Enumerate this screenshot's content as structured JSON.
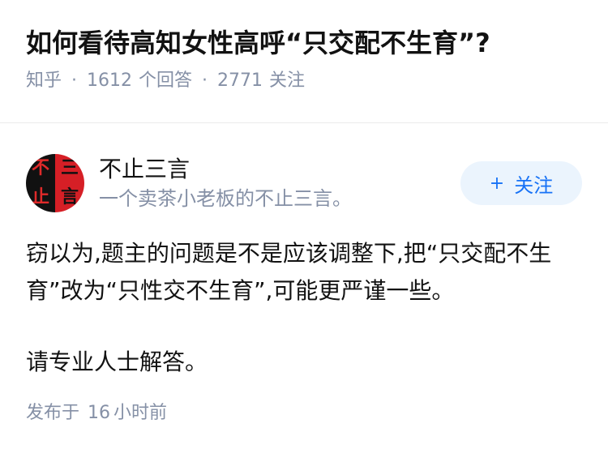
{
  "question": {
    "title": "如何看待高知女性高呼“只交配不生育”?",
    "source": "知乎",
    "answer_count": "1612",
    "answer_label": "个回答",
    "follower_count": "2771",
    "follower_label": "关注"
  },
  "answer": {
    "author": {
      "name": "不止三言",
      "bio": "一个卖茶小老板的不止三言。",
      "avatar_chars": [
        "不",
        "三",
        "止",
        "言"
      ]
    },
    "follow_button": {
      "plus": "+",
      "label": "关注"
    },
    "paragraphs": [
      "窃以为,题主的问题是不是应该调整下,把“只交配不生育”改为“只性交不生育”,可能更严谨一些。",
      "请专业人士解答。"
    ],
    "footer": {
      "published_label": "发布于",
      "published_num": "16",
      "published_unit": "小时前"
    }
  },
  "colors": {
    "meta_gray": "#8590a6",
    "follow_bg": "#ebf4fd",
    "follow_text": "#1772f6",
    "avatar_red": "#d61f26",
    "avatar_black": "#111111"
  }
}
